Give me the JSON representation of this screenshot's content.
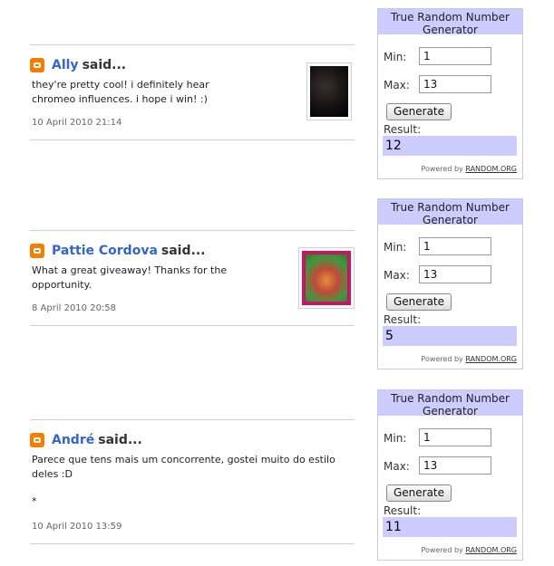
{
  "comments": [
    {
      "author": "Ally",
      "said": "said...",
      "text": "they're pretty cool! i definitely hear chromeo influences. i hope i win! :)",
      "date": "10 April 2010 21:14"
    },
    {
      "author": "Pattie Cordova",
      "said": "said...",
      "text": "What a great giveaway! Thanks for the opportunity.",
      "date": "8 April 2010 20:58"
    },
    {
      "author": "André",
      "said": "said...",
      "text": "Parece que tens mais um concorrente, gostei muito do estilo deles :D",
      "extra": "*",
      "date": "10 April 2010 13:59"
    }
  ],
  "widgets": [
    {
      "title": "True Random Number Generator",
      "min_label": "Min:",
      "min_value": "1",
      "max_label": "Max:",
      "max_value": "13",
      "button": "Generate",
      "result_label": "Result:",
      "result": "12",
      "powered_prefix": "Powered by",
      "powered_link": "RANDOM.ORG"
    },
    {
      "title": "True Random Number Generator",
      "min_label": "Min:",
      "min_value": "1",
      "max_label": "Max:",
      "max_value": "13",
      "button": "Generate",
      "result_label": "Result:",
      "result": "5",
      "powered_prefix": "Powered by",
      "powered_link": "RANDOM.ORG"
    },
    {
      "title": "True Random Number Generator",
      "min_label": "Min:",
      "min_value": "1",
      "max_label": "Max:",
      "max_value": "13",
      "button": "Generate",
      "result_label": "Result:",
      "result": "11",
      "powered_prefix": "Powered by",
      "powered_link": "RANDOM.ORG"
    }
  ],
  "colors": {
    "author_link": "#3366cc",
    "blogger_icon": "#f57d00",
    "widget_header": "#ccccff",
    "result_bg": "#ccccff"
  }
}
